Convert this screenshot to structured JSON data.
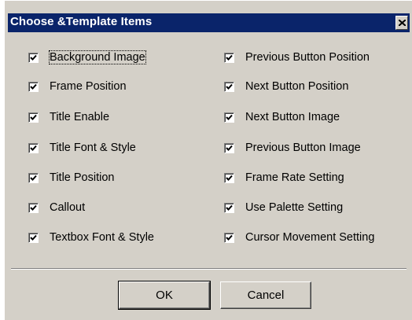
{
  "dialog": {
    "title": "Choose &Template Items",
    "close_symbol": "✕",
    "left_items": [
      {
        "label": "Background Image",
        "checked": true
      },
      {
        "label": "Frame Position",
        "checked": true
      },
      {
        "label": "Title Enable",
        "checked": true
      },
      {
        "label": "Title Font & Style",
        "checked": true
      },
      {
        "label": "Title Position",
        "checked": true
      },
      {
        "label": "Callout",
        "checked": true
      },
      {
        "label": "Textbox Font & Style",
        "checked": true
      }
    ],
    "right_items": [
      {
        "label": "Previous Button Position",
        "checked": true
      },
      {
        "label": "Next Button Position",
        "checked": true
      },
      {
        "label": "Next Button Image",
        "checked": true
      },
      {
        "label": "Previous Button Image",
        "checked": true
      },
      {
        "label": "Frame Rate Setting",
        "checked": true
      },
      {
        "label": "Use Palette Setting",
        "checked": true
      },
      {
        "label": "Cursor Movement Setting",
        "checked": true
      }
    ],
    "ok_label": "OK",
    "cancel_label": "Cancel"
  },
  "colors": {
    "titlebar": "#0a246a",
    "face": "#d4d0c8"
  }
}
